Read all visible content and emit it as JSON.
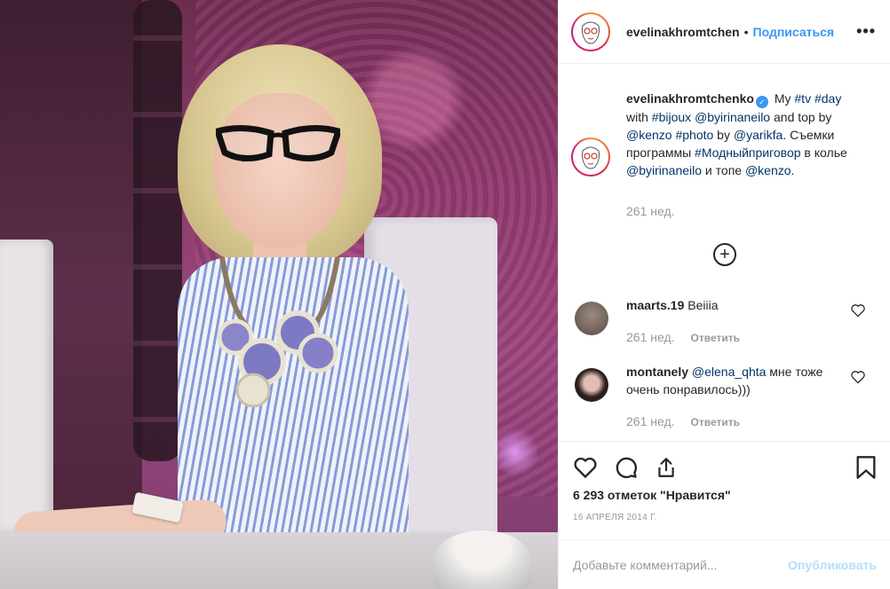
{
  "post": {
    "author": "evelinakhromtchen",
    "separator": "•",
    "follow_label": "Подписаться",
    "more_label": "•••"
  },
  "caption": {
    "username": "evelinakhromtchenko",
    "parts": [
      {
        "text": "My ",
        "type": "text"
      },
      {
        "text": "#tv",
        "type": "tag"
      },
      {
        "text": " ",
        "type": "text"
      },
      {
        "text": "#day",
        "type": "tag"
      },
      {
        "text": " with ",
        "type": "text"
      },
      {
        "text": "#bijoux",
        "type": "tag"
      },
      {
        "text": " ",
        "type": "text"
      },
      {
        "text": "@byirinaneilo",
        "type": "tag"
      },
      {
        "text": " and top by ",
        "type": "text"
      },
      {
        "text": "@kenzo",
        "type": "tag"
      },
      {
        "text": " ",
        "type": "text"
      },
      {
        "text": "#photo",
        "type": "tag"
      },
      {
        "text": " by ",
        "type": "text"
      },
      {
        "text": "@yarikfa",
        "type": "tag"
      },
      {
        "text": ". Съемки программы ",
        "type": "text"
      },
      {
        "text": "#Модныйприговор",
        "type": "tag"
      },
      {
        "text": " в колье ",
        "type": "text"
      },
      {
        "text": "@byirinaneilo",
        "type": "tag"
      },
      {
        "text": " и топе ",
        "type": "text"
      },
      {
        "text": "@kenzo",
        "type": "tag"
      },
      {
        "text": ".",
        "type": "text"
      }
    ],
    "time": "261 нед."
  },
  "load_more_label": "+",
  "comments": [
    {
      "username": "maarts.19",
      "text": "Beiiia",
      "time": "261 нед.",
      "reply_label": "Ответить",
      "avatar_color": "#6b5a52"
    },
    {
      "username": "montanely",
      "mention": "@elena_qhta",
      "text": " мне тоже очень понравилось)))",
      "time": "261 нед.",
      "reply_label": "Ответить",
      "avatar_color": "#3a2b2b"
    }
  ],
  "likes": "6 293 отметок \"Нравится\"",
  "date": "16 апреля 2014 г.",
  "comment_box": {
    "placeholder": "Добавьте комментарий...",
    "publish_label": "Опубликовать"
  },
  "colors": {
    "link": "#3897f0",
    "tag": "#003569",
    "muted": "#999999",
    "publish_disabled": "#b2dffc"
  }
}
